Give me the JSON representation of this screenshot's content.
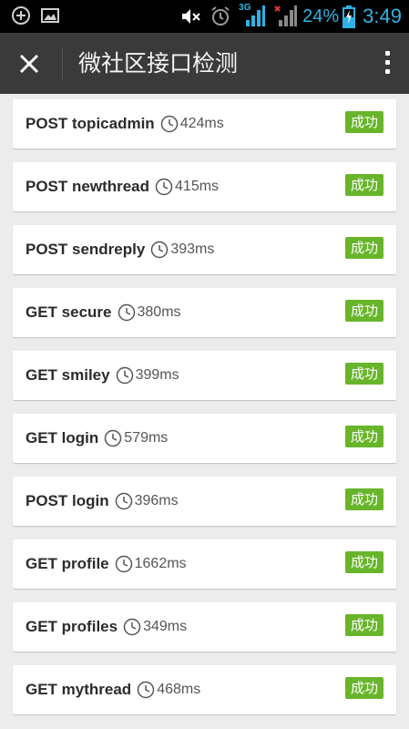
{
  "status_bar": {
    "signal_label": "3G",
    "battery_percent": "24%",
    "time": "3:49"
  },
  "app_bar": {
    "title": "微社区接口检测"
  },
  "items": [
    {
      "name": "POST topicadmin",
      "latency": "424ms",
      "status": "成功"
    },
    {
      "name": "POST newthread",
      "latency": "415ms",
      "status": "成功"
    },
    {
      "name": "POST sendreply",
      "latency": "393ms",
      "status": "成功"
    },
    {
      "name": "GET secure",
      "latency": "380ms",
      "status": "成功"
    },
    {
      "name": "GET smiley",
      "latency": "399ms",
      "status": "成功"
    },
    {
      "name": "GET login",
      "latency": "579ms",
      "status": "成功"
    },
    {
      "name": "POST login",
      "latency": "396ms",
      "status": "成功"
    },
    {
      "name": "GET profile",
      "latency": "1662ms",
      "status": "成功"
    },
    {
      "name": "GET profiles",
      "latency": "349ms",
      "status": "成功"
    },
    {
      "name": "GET mythread",
      "latency": "468ms",
      "status": "成功"
    }
  ],
  "colors": {
    "success_badge": "#68b52b",
    "app_bar": "#3a3a3a",
    "status_icons": "#2fb3e6"
  }
}
